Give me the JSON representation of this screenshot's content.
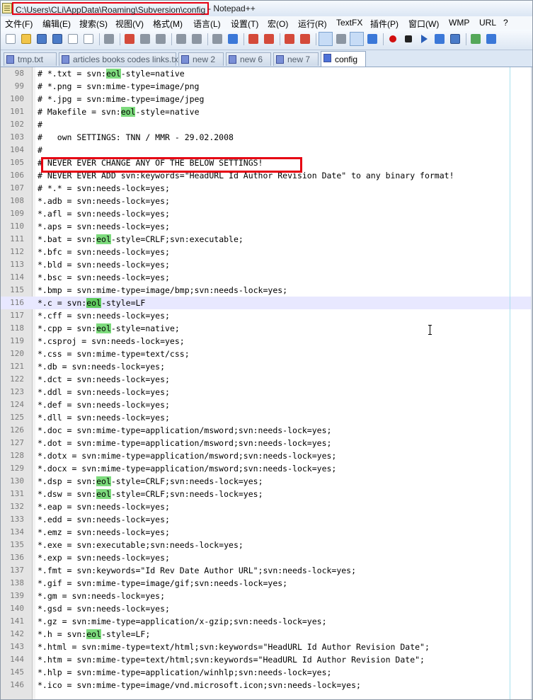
{
  "title_bar": {
    "path": "C:\\Users\\CLi\\AppData\\Roaming\\Subversion\\config",
    "suffix": " - Notepad++"
  },
  "menu": [
    "文件(F)",
    "编辑(E)",
    "搜索(S)",
    "视图(V)",
    "格式(M)",
    "语言(L)",
    "设置(T)",
    "宏(O)",
    "运行(R)",
    "TextFX",
    "插件(P)",
    "窗口(W)",
    "WMP",
    "URL",
    "?"
  ],
  "toolbar_icons": [
    "new-file-icon",
    "open-file-icon",
    "save-icon",
    "save-all-icon",
    "close-icon",
    "close-all-icon",
    "print-icon",
    "cut-icon",
    "copy-icon",
    "paste-icon",
    "undo-icon",
    "redo-icon",
    "find-icon",
    "replace-icon",
    "zoom-in-icon",
    "zoom-out-icon",
    "sync-vertical-icon",
    "sync-horizontal-icon",
    "word-wrap-icon",
    "show-all-chars-icon",
    "indent-guide-icon",
    "user-lang-icon",
    "record-macro-icon",
    "stop-recording-icon",
    "play-macro-icon",
    "run-macro-multiple-icon",
    "save-macro-icon",
    "wmp-icon",
    "url-icon"
  ],
  "tabs": [
    {
      "label": "tmp.txt",
      "active": false
    },
    {
      "label": "articles books codes links.txt",
      "active": false
    },
    {
      "label": "new  2",
      "active": false
    },
    {
      "label": "new  6",
      "active": false
    },
    {
      "label": "new  7",
      "active": false
    },
    {
      "label": "config",
      "active": true
    }
  ],
  "editor": {
    "current_line": 116,
    "boxed_line": 105,
    "highlight_word": "eol",
    "lines": [
      {
        "n": "98",
        "text": "# *.txt = svn:eol-style=native"
      },
      {
        "n": "99",
        "text": "# *.png = svn:mime-type=image/png"
      },
      {
        "n": "100",
        "text": "# *.jpg = svn:mime-type=image/jpeg"
      },
      {
        "n": "101",
        "text": "# Makefile = svn:eol-style=native"
      },
      {
        "n": "102",
        "text": "#"
      },
      {
        "n": "103",
        "text": "#   own SETTINGS: TNN / MMR - 29.02.2008"
      },
      {
        "n": "104",
        "text": "#"
      },
      {
        "n": "105",
        "text": "# NEVER EVER CHANGE ANY OF THE BELOW SETTINGS!"
      },
      {
        "n": "106",
        "text": "# NEVER EVER ADD svn:keywords=\"HeadURL Id Author Revision Date\" to any binary format!"
      },
      {
        "n": "107",
        "text": "# *.* = svn:needs-lock=yes;"
      },
      {
        "n": "108",
        "text": "*.adb = svn:needs-lock=yes;"
      },
      {
        "n": "109",
        "text": "*.afl = svn:needs-lock=yes;"
      },
      {
        "n": "110",
        "text": "*.aps = svn:needs-lock=yes;"
      },
      {
        "n": "111",
        "text": "*.bat = svn:eol-style=CRLF;svn:executable;"
      },
      {
        "n": "112",
        "text": "*.bfc = svn:needs-lock=yes;"
      },
      {
        "n": "113",
        "text": "*.bld = svn:needs-lock=yes;"
      },
      {
        "n": "114",
        "text": "*.bsc = svn:needs-lock=yes;"
      },
      {
        "n": "115",
        "text": "*.bmp = svn:mime-type=image/bmp;svn:needs-lock=yes;"
      },
      {
        "n": "116",
        "text": "*.c = svn:eol-style=LF"
      },
      {
        "n": "117",
        "text": "*.cff = svn:needs-lock=yes;"
      },
      {
        "n": "118",
        "text": "*.cpp = svn:eol-style=native;"
      },
      {
        "n": "119",
        "text": "*.csproj = svn:needs-lock=yes;"
      },
      {
        "n": "120",
        "text": "*.css = svn:mime-type=text/css;"
      },
      {
        "n": "121",
        "text": "*.db = svn:needs-lock=yes;"
      },
      {
        "n": "122",
        "text": "*.dct = svn:needs-lock=yes;"
      },
      {
        "n": "123",
        "text": "*.ddl = svn:needs-lock=yes;"
      },
      {
        "n": "124",
        "text": "*.def = svn:needs-lock=yes;"
      },
      {
        "n": "125",
        "text": "*.dll = svn:needs-lock=yes;"
      },
      {
        "n": "126",
        "text": "*.doc = svn:mime-type=application/msword;svn:needs-lock=yes;"
      },
      {
        "n": "127",
        "text": "*.dot = svn:mime-type=application/msword;svn:needs-lock=yes;"
      },
      {
        "n": "128",
        "text": "*.dotx = svn:mime-type=application/msword;svn:needs-lock=yes;"
      },
      {
        "n": "129",
        "text": "*.docx = svn:mime-type=application/msword;svn:needs-lock=yes;"
      },
      {
        "n": "130",
        "text": "*.dsp = svn:eol-style=CRLF;svn:needs-lock=yes;"
      },
      {
        "n": "131",
        "text": "*.dsw = svn:eol-style=CRLF;svn:needs-lock=yes;"
      },
      {
        "n": "132",
        "text": "*.eap = svn:needs-lock=yes;"
      },
      {
        "n": "133",
        "text": "*.edd = svn:needs-lock=yes;"
      },
      {
        "n": "134",
        "text": "*.emz = svn:needs-lock=yes;"
      },
      {
        "n": "135",
        "text": "*.exe = svn:executable;svn:needs-lock=yes;"
      },
      {
        "n": "136",
        "text": "*.exp = svn:needs-lock=yes;"
      },
      {
        "n": "137",
        "text": "*.fmt = svn:keywords=\"Id Rev Date Author URL\";svn:needs-lock=yes;"
      },
      {
        "n": "138",
        "text": "*.gif = svn:mime-type=image/gif;svn:needs-lock=yes;"
      },
      {
        "n": "139",
        "text": "*.gm = svn:needs-lock=yes;"
      },
      {
        "n": "140",
        "text": "*.gsd = svn:needs-lock=yes;"
      },
      {
        "n": "141",
        "text": "*.gz = svn:mime-type=application/x-gzip;svn:needs-lock=yes;"
      },
      {
        "n": "142",
        "text": "*.h = svn:eol-style=LF;"
      },
      {
        "n": "143",
        "text": "*.html = svn:mime-type=text/html;svn:keywords=\"HeadURL Id Author Revision Date\";"
      },
      {
        "n": "144",
        "text": "*.htm = svn:mime-type=text/html;svn:keywords=\"HeadURL Id Author Revision Date\";"
      },
      {
        "n": "145",
        "text": "*.hlp = svn:mime-type=application/winhlp;svn:needs-lock=yes;"
      },
      {
        "n": "146",
        "text": "*.ico = svn:mime-type=image/vnd.microsoft.icon;svn:needs-lock=yes;"
      }
    ]
  },
  "colors": {
    "annotation_red": "#e60012",
    "eol_highlight": "#7ddb7d",
    "current_line": "#e8e8ff",
    "edge_line": "#a8e1ee"
  }
}
